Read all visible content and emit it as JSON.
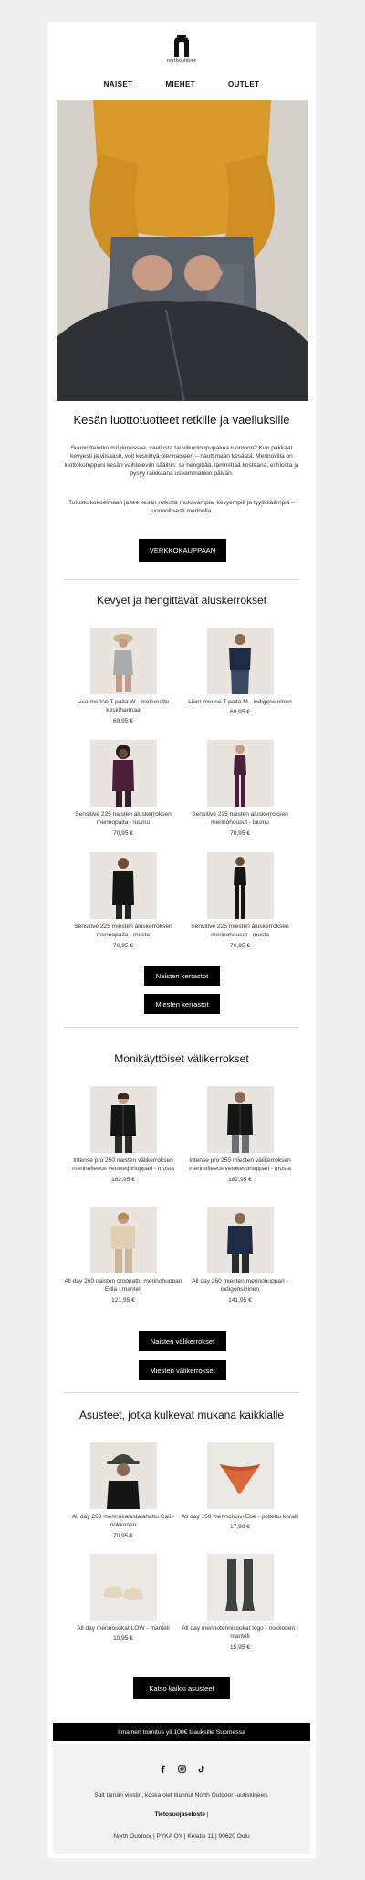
{
  "brand": {
    "name": "northoutdoor"
  },
  "nav": {
    "items": [
      "NAISET",
      "MIEHET",
      "OUTLET"
    ]
  },
  "hero": {
    "title": "Kesän luottotuotteet retkille ja vaelluksille",
    "paragraph1": "Suunnitteletko mökkireissua, vaellusta tai viikonloppupakoa luontoon? Kun pakkaat kevyesti ja viisaasti, voit keskittyä olennaiseen – nauttimaan kesästä. Merinovilla on luottokumppani kesän vaihteleviin sääihin: se hengittää, lämmittää kosteana, ei hiosta ja pysyy raikkaana useammankin päivän.",
    "paragraph2": "Tutustu kokoelmaan ja tee kesän retkistä mukavampia, kevyempiä ja tyylikkäämpiä – luonnollisesti merinolla.",
    "cta": "VERKKOKAUPPAAN"
  },
  "section1": {
    "title": "Kevyet ja hengittävät aluskerrokset",
    "products": [
      {
        "name": "Lisa merino T-paita W - meleerattu keskiharmaa",
        "price": "69,95 €"
      },
      {
        "name": "Liam merino T-paita M - indigonsininen",
        "price": "69,95 €"
      },
      {
        "name": "Sensitive 225 naisten aluskerroksen merinopaita - luumu",
        "price": "70,95 €"
      },
      {
        "name": "Sensitive 225 naisten aluskerroksen merinohousut - luumu",
        "price": "70,95 €"
      },
      {
        "name": "Sensitive 225 miesten aluskerroksen merinopaita - musta",
        "price": "70,95 €"
      },
      {
        "name": "Sensitive 225 miesten aluskerroksen merinohousut - musta",
        "price": "70,95 €"
      }
    ],
    "button_women": "Naisten kerrastot",
    "button_men": "Miesten kerrastot"
  },
  "section2": {
    "title": "Monikäyttöiset välikerrokset",
    "products": [
      {
        "name": "Intense pro 250 naisten välikerroksen merinofleece vetoketjuhuppari - musta",
        "price": "182,95 €"
      },
      {
        "name": "Intense pro 250 miesten välikerroksen merinofleece vetoketjuhuppari - musta",
        "price": "182,95 €"
      },
      {
        "name": "All day 260 naisten croppattu merinohuppari Edla - manteli",
        "price": "121,95 €"
      },
      {
        "name": "All day 260 miesten merinohuppari - indigonsininen",
        "price": "141,95 €"
      }
    ],
    "button_women": "Naisten välikerrokset",
    "button_men": "Miesten välikerrokset"
  },
  "section3": {
    "title": "Asusteet, jotka kulkevat mukana kaikkialle",
    "products": [
      {
        "name": "All day 250 merinokalastajahattu Cali - nokkonen",
        "price": "70,95 €"
      },
      {
        "name": "All day 150 merinohuivi Ebe - poltettu koralli",
        "price": "17,98 €"
      },
      {
        "name": "All day merinosukat LOW - manteli",
        "price": "10,95 €"
      },
      {
        "name": "All day merinotennissukat logo - nokkonen | manteli",
        "price": "15,95 €"
      }
    ],
    "button_all": "Katso kaikki asusteet"
  },
  "banner": {
    "text": "Ilmainen toimitus yli 100€ tilauksille Suomessa"
  },
  "footer": {
    "socials": [
      "facebook-icon",
      "instagram-icon",
      "tiktok-icon"
    ],
    "notice": "Sait tämän viestin, koska olet tilannut North Outdoor -uutiskirjeen.",
    "privacy": "Tietosuojaseloste",
    "privacy_sep": " |",
    "address": "North Outdoor | PYKA OY | Kelatie 11 | 90620 Oulu"
  },
  "colors": {
    "accent": "#000000",
    "background": "#efefef",
    "hero_sweater": "#d99a2b",
    "hero_pants": "#5a6168"
  }
}
